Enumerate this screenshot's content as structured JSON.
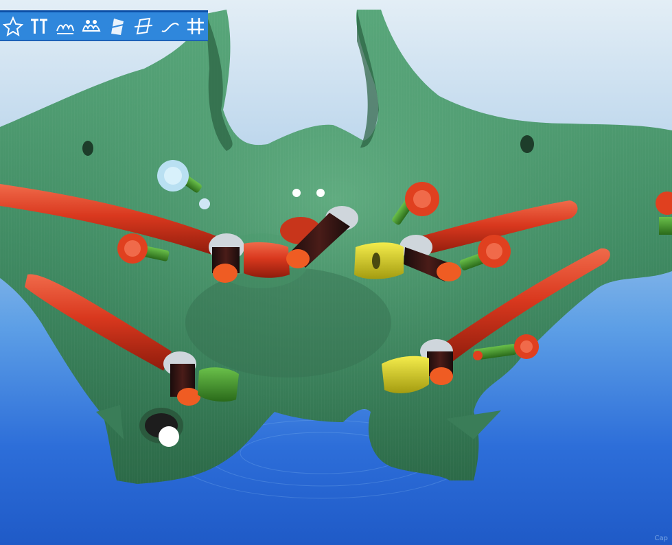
{
  "app": {
    "colors": {
      "bone": "#3f8a62",
      "bone_shade": "#2f6d4b",
      "background_top": "#e3eef6",
      "background_bottom": "#1f5ac7",
      "implant_red": "#d9381e",
      "abutment_yellow": "#d6cf1e",
      "abutment_green": "#3d8a2a",
      "toolbar": "#2f87dc"
    }
  },
  "toolbar": {
    "tools": [
      {
        "icon": "star-tool-icon"
      },
      {
        "icon": "implant-pair-icon"
      },
      {
        "icon": "bone-profile-icon"
      },
      {
        "icon": "crowns-icon"
      },
      {
        "icon": "cut-plane-icon"
      },
      {
        "icon": "rotate-plane-icon"
      },
      {
        "icon": "curve-tool-icon"
      },
      {
        "icon": "grid-icon"
      }
    ]
  },
  "scene": {
    "implants": [
      {
        "id": "zygomatic-left-upper",
        "color": "red"
      },
      {
        "id": "zygomatic-left-lower",
        "color": "red"
      },
      {
        "id": "zygomatic-right-upper",
        "color": "red"
      },
      {
        "id": "zygomatic-right-lower",
        "color": "red"
      },
      {
        "id": "anterior-left",
        "color": "red"
      },
      {
        "id": "anterior-right",
        "color": "yellow"
      }
    ],
    "screws": [
      {
        "id": "screw-light-blue",
        "color": "light-blue"
      },
      {
        "id": "screw-left",
        "color": "red"
      },
      {
        "id": "screw-center-right",
        "color": "red"
      },
      {
        "id": "screw-right",
        "color": "red"
      },
      {
        "id": "screw-right-lower",
        "color": "red"
      },
      {
        "id": "screw-edge-right",
        "color": "red"
      }
    ]
  },
  "status": {
    "caption": "Сар"
  }
}
